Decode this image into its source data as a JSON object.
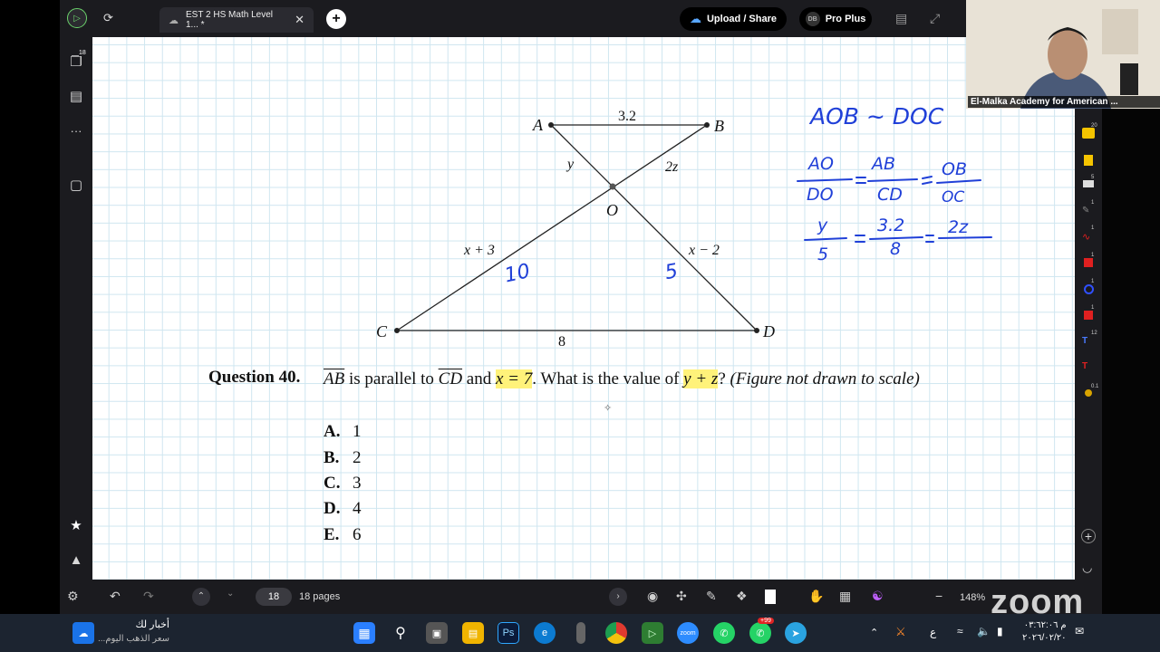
{
  "app": {
    "tab_title": "EST 2 HS Math Level 1... *",
    "upload_label": "Upload / Share",
    "plan_label": "Pro Plus",
    "avatar_initials": "DB",
    "pages_badge": "18"
  },
  "figure": {
    "labels": {
      "A": "A",
      "B": "B",
      "C": "C",
      "D": "D",
      "O": "O"
    },
    "segments": {
      "ab": "3.2",
      "ao": "y",
      "ob": "2z",
      "co": "x + 3",
      "od": "x − 2",
      "cd": "8"
    }
  },
  "question": {
    "head": "Question 40.",
    "seg1": "AB",
    "t1": " is parallel to ",
    "seg2": "CD",
    "t2": " and ",
    "hl1": "x = 7",
    "t3": ". What is the value of ",
    "hl2": "y + z",
    "t4": "? ",
    "note": "(Figure not drawn to scale)",
    "choices": [
      {
        "letter": "A.",
        "value": "1"
      },
      {
        "letter": "B.",
        "value": "2"
      },
      {
        "letter": "C.",
        "value": "3"
      },
      {
        "letter": "D.",
        "value": "4"
      },
      {
        "letter": "E.",
        "value": "6"
      }
    ]
  },
  "handwriting": {
    "co_value": "10",
    "od_value": "5",
    "similarity": "AOB ~ DOC",
    "ratio_line": [
      "AO",
      "DO",
      "AB",
      "CD",
      "OB",
      "OC"
    ],
    "sub_line": [
      "y",
      "5",
      "3.2",
      "8",
      "2z"
    ]
  },
  "right_tools": [
    "20",
    "5",
    "1",
    "1",
    "1",
    "1",
    "1",
    "12",
    "0.1"
  ],
  "bottom": {
    "page_current": "18",
    "page_count": "18 pages",
    "zoom": "148%"
  },
  "webcam": {
    "label": "El-Malka Academy for American ..."
  },
  "watermark": "zoom",
  "taskbar": {
    "news_title": "أخبار لك",
    "news_sub": "سعر الذهب اليوم...",
    "badge": "+99",
    "lang": "ع",
    "time": "م ٠٣:٦٢:٠٦",
    "date": "٢٠٢٦/٠٢/٢٠"
  }
}
